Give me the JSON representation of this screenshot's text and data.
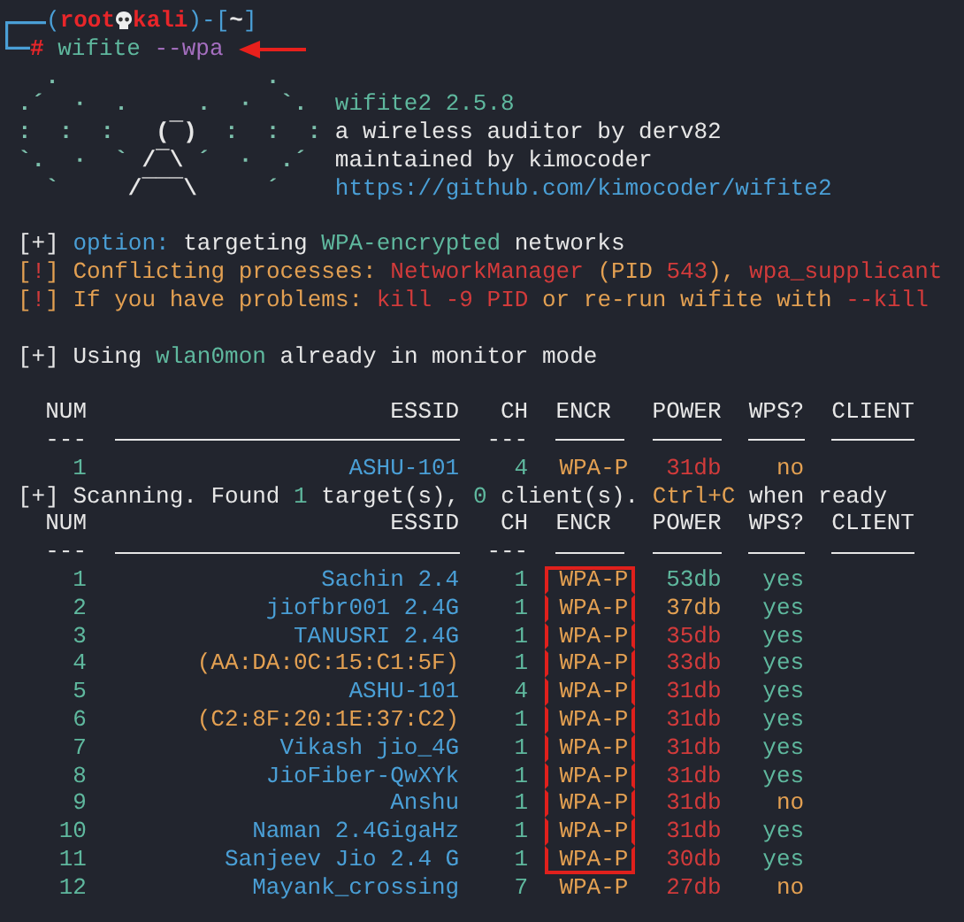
{
  "prompt": {
    "open": "(",
    "user": "root",
    "host": "kali",
    "close": ")-[",
    "dir": "~",
    "end": "]",
    "symbol": "#",
    "command": "wifite",
    "option": "--wpa"
  },
  "art_top": [
    {
      "text": ".",
      "color": "#7cc0ac"
    },
    {
      "text": ".",
      "color": "#7cc0ac"
    }
  ],
  "art": [
    [
      {
        "text": ".´  ·  .     .  ·  `.",
        "color": "#7cc0ac"
      }
    ],
    [
      {
        "text": ":  :  :",
        "color": "#7cc0ac"
      },
      {
        "text": "(¯)",
        "color": "#e6e6e6"
      },
      {
        "text": ":  :  :",
        "color": "#7cc0ac"
      }
    ],
    [
      {
        "text": "`.  ·  `",
        "color": "#7cc0ac"
      },
      {
        "text": "/¯\\",
        "color": "#e6e6e6"
      },
      {
        "text": "´  ·  .´",
        "color": "#7cc0ac"
      }
    ],
    [
      {
        "text": "`",
        "color": "#7cc0ac"
      },
      {
        "text": "/¯¯¯\\",
        "color": "#e6e6e6"
      },
      {
        "text": "´",
        "color": "#7cc0ac"
      }
    ]
  ],
  "banner": [
    {
      "text": "wifite2 2.5.8",
      "color": "#5fb89e"
    },
    {
      "text": "a wireless auditor by derv82",
      "color": "#e6e6e6"
    },
    {
      "text": "maintained by kimocoder",
      "color": "#e6e6e6"
    },
    {
      "text": "https://github.com/kimocoder/wifite2",
      "color": "#4a9fd6"
    }
  ],
  "messages": [
    [
      {
        "text": "[+]",
        "color": "#e6e6e6"
      },
      {
        "text": " option:",
        "color": "#4a9fd6"
      },
      {
        "text": " targeting ",
        "color": "#e6e6e6"
      },
      {
        "text": "WPA-encrypted",
        "color": "#5fb89e"
      },
      {
        "text": " networks",
        "color": "#e6e6e6"
      }
    ],
    [
      {
        "text": "[",
        "color": "#e3a052"
      },
      {
        "text": "!",
        "color": "#d23b3b"
      },
      {
        "text": "] Conflicting processes: ",
        "color": "#e3a052"
      },
      {
        "text": "NetworkManager",
        "color": "#d23b3b"
      },
      {
        "text": " (PID ",
        "color": "#e3a052"
      },
      {
        "text": "543",
        "color": "#d23b3b"
      },
      {
        "text": "), ",
        "color": "#e3a052"
      },
      {
        "text": "wpa_supplicant",
        "color": "#d23b3b"
      }
    ],
    [
      {
        "text": "[",
        "color": "#e3a052"
      },
      {
        "text": "!",
        "color": "#d23b3b"
      },
      {
        "text": "] If you have problems: ",
        "color": "#e3a052"
      },
      {
        "text": "kill -9 PID",
        "color": "#d23b3b"
      },
      {
        "text": " or re-run wifite with ",
        "color": "#e3a052"
      },
      {
        "text": "--kill",
        "color": "#d23b3b"
      }
    ]
  ],
  "monitor": [
    {
      "text": "[+] Using ",
      "color": "#e6e6e6"
    },
    {
      "text": "wlan0mon",
      "color": "#5fb89e"
    },
    {
      "text": " already in monitor mode",
      "color": "#e6e6e6"
    }
  ],
  "first_scan": {
    "columns": [
      {
        "label": "NUM",
        "underline": "---"
      },
      {
        "label": "ESSID"
      },
      {
        "label": "CH",
        "underline": "---"
      },
      {
        "label": "ENCR"
      },
      {
        "label": "POWER"
      },
      {
        "label": "WPS?"
      },
      {
        "label": "CLIENT"
      }
    ],
    "rows": [
      {
        "num": "1",
        "essid": "ASHU-101",
        "hidden": false,
        "ch": "4",
        "encr": "WPA-P",
        "power": {
          "text": "31db",
          "color": "#d23b3b"
        },
        "wps": {
          "text": "no",
          "color": "#e3a052"
        },
        "boxed": false
      }
    ]
  },
  "status": [
    {
      "text": "[+] Scanning. Found ",
      "color": "#e6e6e6"
    },
    {
      "text": "1",
      "color": "#5fb89e"
    },
    {
      "text": " target(s), ",
      "color": "#e6e6e6"
    },
    {
      "text": "0",
      "color": "#5fb89e"
    },
    {
      "text": " client(s). ",
      "color": "#e6e6e6"
    },
    {
      "text": "Ctrl+C",
      "color": "#e3a052"
    },
    {
      "text": " when ready",
      "color": "#e6e6e6"
    }
  ],
  "targets": {
    "columns": [
      {
        "label": "NUM",
        "underline": "---"
      },
      {
        "label": "ESSID"
      },
      {
        "label": "CH",
        "underline": "---"
      },
      {
        "label": "ENCR"
      },
      {
        "label": "POWER"
      },
      {
        "label": "WPS?"
      },
      {
        "label": "CLIENT"
      }
    ],
    "rows": [
      {
        "num": "1",
        "essid": "Sachin 2.4",
        "hidden": false,
        "ch": "1",
        "encr": "WPA-P",
        "power": {
          "text": "53db",
          "color": "#5fb89e"
        },
        "wps": {
          "text": "yes",
          "color": "#5fb89e"
        },
        "boxed": true
      },
      {
        "num": "2",
        "essid": "jiofbr001 2.4G",
        "hidden": false,
        "ch": "1",
        "encr": "WPA-P",
        "power": {
          "text": "37db",
          "color": "#e3a052"
        },
        "wps": {
          "text": "yes",
          "color": "#5fb89e"
        },
        "boxed": true
      },
      {
        "num": "3",
        "essid": "TANUSRI 2.4G",
        "hidden": false,
        "ch": "1",
        "encr": "WPA-P",
        "power": {
          "text": "35db",
          "color": "#d23b3b"
        },
        "wps": {
          "text": "yes",
          "color": "#5fb89e"
        },
        "boxed": true
      },
      {
        "num": "4",
        "essid": "(AA:DA:0C:15:C1:5F)",
        "hidden": true,
        "ch": "1",
        "encr": "WPA-P",
        "power": {
          "text": "33db",
          "color": "#d23b3b"
        },
        "wps": {
          "text": "yes",
          "color": "#5fb89e"
        },
        "boxed": true
      },
      {
        "num": "5",
        "essid": "ASHU-101",
        "hidden": false,
        "ch": "4",
        "encr": "WPA-P",
        "power": {
          "text": "31db",
          "color": "#d23b3b"
        },
        "wps": {
          "text": "yes",
          "color": "#5fb89e"
        },
        "boxed": true
      },
      {
        "num": "6",
        "essid": "(C2:8F:20:1E:37:C2)",
        "hidden": true,
        "ch": "1",
        "encr": "WPA-P",
        "power": {
          "text": "31db",
          "color": "#d23b3b"
        },
        "wps": {
          "text": "yes",
          "color": "#5fb89e"
        },
        "boxed": true
      },
      {
        "num": "7",
        "essid": "Vikash jio_4G",
        "hidden": false,
        "ch": "1",
        "encr": "WPA-P",
        "power": {
          "text": "31db",
          "color": "#d23b3b"
        },
        "wps": {
          "text": "yes",
          "color": "#5fb89e"
        },
        "boxed": true
      },
      {
        "num": "8",
        "essid": "JioFiber-QwXYk",
        "hidden": false,
        "ch": "1",
        "encr": "WPA-P",
        "power": {
          "text": "31db",
          "color": "#d23b3b"
        },
        "wps": {
          "text": "yes",
          "color": "#5fb89e"
        },
        "boxed": true
      },
      {
        "num": "9",
        "essid": "Anshu",
        "hidden": false,
        "ch": "1",
        "encr": "WPA-P",
        "power": {
          "text": "31db",
          "color": "#d23b3b"
        },
        "wps": {
          "text": "no",
          "color": "#e3a052"
        },
        "boxed": true
      },
      {
        "num": "10",
        "essid": "Naman 2.4GigaHz",
        "hidden": false,
        "ch": "1",
        "encr": "WPA-P",
        "power": {
          "text": "31db",
          "color": "#d23b3b"
        },
        "wps": {
          "text": "yes",
          "color": "#5fb89e"
        },
        "boxed": true
      },
      {
        "num": "11",
        "essid": "Sanjeev Jio 2.4 G",
        "hidden": false,
        "ch": "1",
        "encr": "WPA-P",
        "power": {
          "text": "30db",
          "color": "#d23b3b"
        },
        "wps": {
          "text": "yes",
          "color": "#5fb89e"
        },
        "boxed": true
      },
      {
        "num": "12",
        "essid": "Mayank_crossing",
        "hidden": false,
        "ch": "7",
        "encr": "WPA-P",
        "power": {
          "text": "27db",
          "color": "#d23b3b"
        },
        "wps": {
          "text": "no",
          "color": "#e3a052"
        },
        "boxed": false
      }
    ]
  }
}
